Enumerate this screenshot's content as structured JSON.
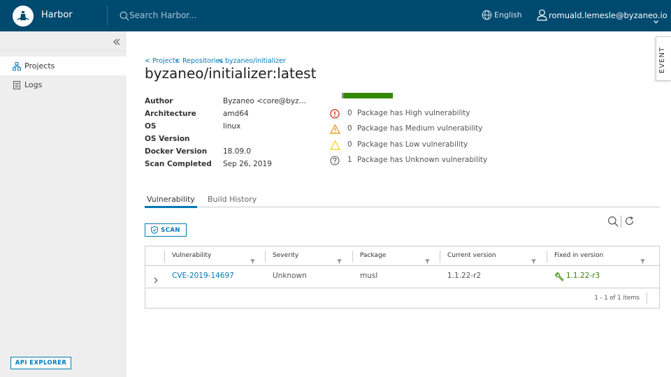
{
  "header": {
    "brand": "Harbor",
    "search_placeholder": "Search Harbor...",
    "language": "English",
    "user": "romuald.lemesle@byzaneo.io"
  },
  "sidebar": {
    "items": [
      {
        "label": "Projects",
        "icon": "projects-icon",
        "active": true
      },
      {
        "label": "Logs",
        "icon": "logs-icon",
        "active": false
      }
    ],
    "api_explorer": "API EXPLORER"
  },
  "event_tab": "EVENT",
  "breadcrumb": [
    "< Projects",
    "< Repositories",
    "< byzaneo/initializer"
  ],
  "title": "byzaneo/initializer:latest",
  "properties": [
    {
      "key": "Author",
      "value": "Byzaneo <core@byzaneo.io>"
    },
    {
      "key": "Architecture",
      "value": "amd64"
    },
    {
      "key": "OS",
      "value": "linux"
    },
    {
      "key": "OS Version",
      "value": ""
    },
    {
      "key": "Docker Version",
      "value": "18.09.0"
    },
    {
      "key": "Scan Completed",
      "value": "Sep 26, 2019"
    }
  ],
  "severity_summary": [
    {
      "count": "0",
      "label": "Package has High vulnerability",
      "icon": "error-circle-icon",
      "color": "#c92100"
    },
    {
      "count": "0",
      "label": "Package has Medium vulnerability",
      "icon": "warning-triangle-icon",
      "color": "#eb8d00"
    },
    {
      "count": "0",
      "label": "Package has Low vulnerability",
      "icon": "warning-triangle-outline-icon",
      "color": "#fdd006"
    },
    {
      "count": "1",
      "label": "Package has Unknown vulnerability",
      "icon": "question-circle-icon",
      "color": "#565656"
    }
  ],
  "colors": {
    "header": "#004a70",
    "accent": "#0079b8",
    "ok": "#318700"
  },
  "tabs": [
    "Vulnerability",
    "Build History"
  ],
  "scan_label": "SCAN",
  "grid": {
    "columns": [
      "Vulnerability",
      "Severity",
      "Package",
      "Current version",
      "Fixed in version"
    ],
    "rows": [
      {
        "vulnerability": "CVE-2019-14697",
        "severity": "Unknown",
        "package": "musl",
        "current": "1.1.22-r2",
        "fixed": "1.1.22-r3"
      }
    ],
    "footer": "1 - 1 of 1 items"
  }
}
